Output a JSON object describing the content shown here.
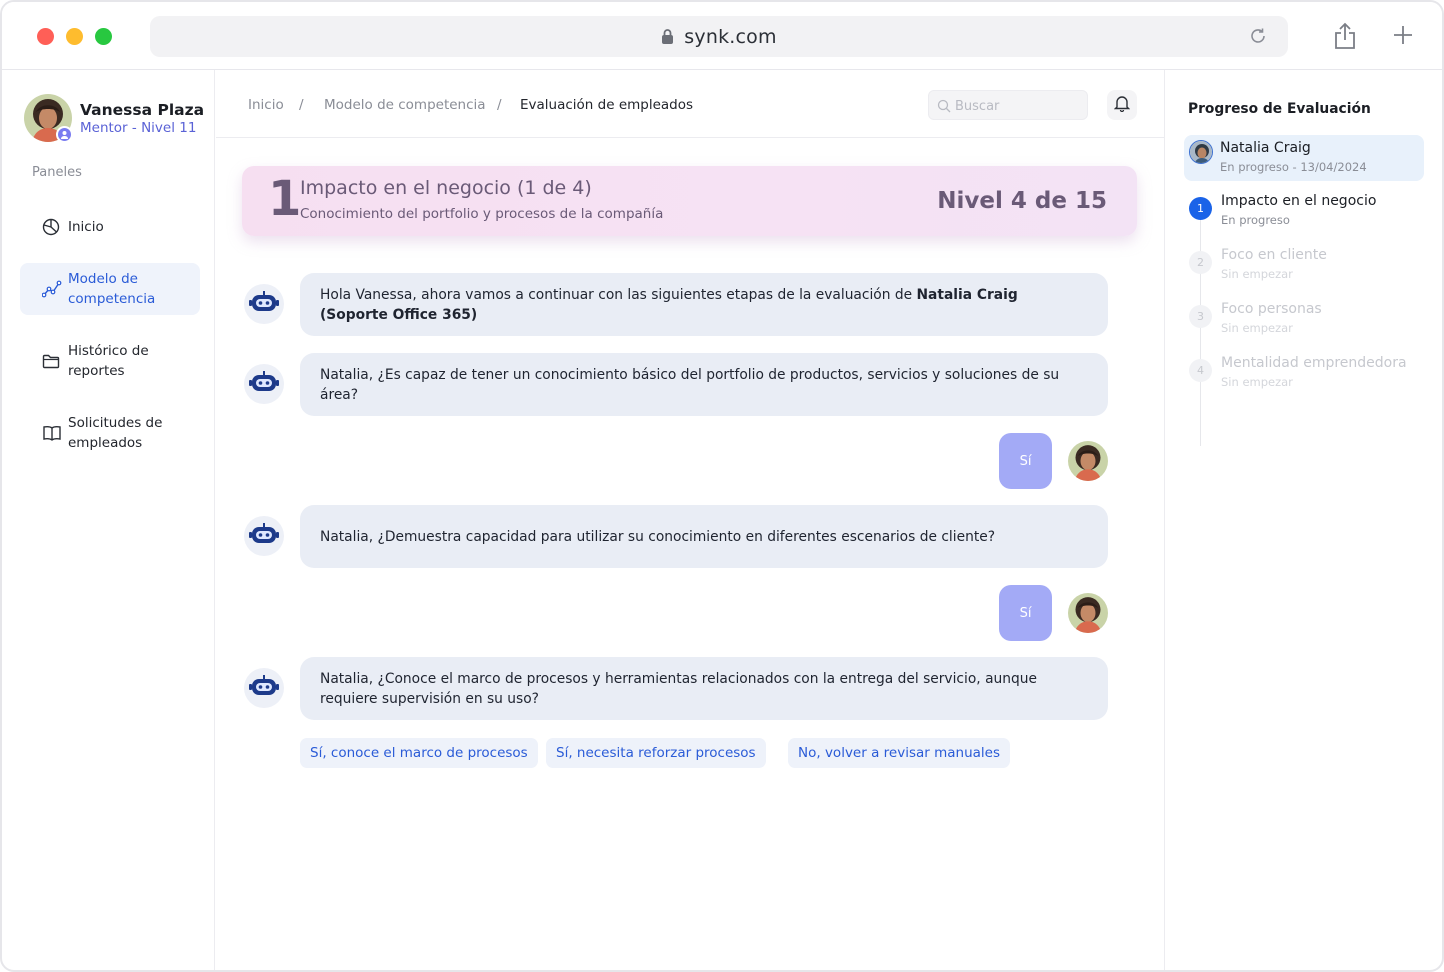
{
  "browser": {
    "url": "synk.com"
  },
  "user": {
    "name": "Vanessa Plaza",
    "role": "Mentor - Nivel 11"
  },
  "sidebar": {
    "section_label": "Paneles",
    "items": [
      {
        "label": "Inicio",
        "icon": "pie-chart-icon",
        "active": false
      },
      {
        "label": "Modelo de competencia",
        "icon": "trend-line-icon",
        "active": true
      },
      {
        "label": "Histórico de reportes",
        "icon": "folder-icon",
        "active": false
      },
      {
        "label": "Solicitudes de empleados",
        "icon": "book-icon",
        "active": false
      }
    ]
  },
  "breadcrumb": {
    "items": [
      "Inicio",
      "Modelo de competencia",
      "Evaluación de empleados"
    ],
    "separator": "/"
  },
  "search": {
    "placeholder": "Buscar"
  },
  "banner": {
    "number": "1",
    "title": "Impacto en el negocio (1 de 4)",
    "subtitle": "Conocimiento del portfolio y procesos de la compañía",
    "level": "Nivel 4 de 15"
  },
  "chat": {
    "msg1": {
      "pre": "Hola Vanessa, ahora vamos a continuar con las siguientes etapas de la evaluación de ",
      "bold": "Natalia Craig (Soporte Office 365)"
    },
    "msg2": "Natalia,  ¿Es capaz de tener un conocimiento básico del portfolio de productos, servicios y soluciones de su área?",
    "reply1": "Sí",
    "msg3": "Natalia,  ¿Demuestra capacidad para utilizar su conocimiento en diferentes escenarios de cliente?",
    "reply2": "Sí",
    "msg4": "Natalia,  ¿Conoce el marco de procesos y herramientas relacionados con la entrega del servicio, aunque requiere supervisión en su uso?",
    "options": [
      "Sí, conoce el marco de procesos",
      "Sí, necesita reforzar procesos",
      "No, volver a revisar manuales"
    ]
  },
  "progress": {
    "title": "Progreso de Evaluación",
    "employee": {
      "name": "Natalia Craig",
      "status": "En progreso - 13/04/2024"
    },
    "steps": [
      {
        "num": "1",
        "title": "Impacto en el negocio",
        "status": "En progreso",
        "state": "active"
      },
      {
        "num": "2",
        "title": "Foco en cliente",
        "status": "Sin empezar",
        "state": "inactive"
      },
      {
        "num": "3",
        "title": "Foco personas",
        "status": "Sin empezar",
        "state": "inactive"
      },
      {
        "num": "4",
        "title": "Mentalidad emprendedora",
        "status": "Sin empezar",
        "state": "inactive"
      }
    ]
  },
  "colors": {
    "accent": "#2a5bd7",
    "reply_bubble": "#a3aaf6",
    "banner_bg": "#f6dff1",
    "step_active": "#1a63e8"
  }
}
